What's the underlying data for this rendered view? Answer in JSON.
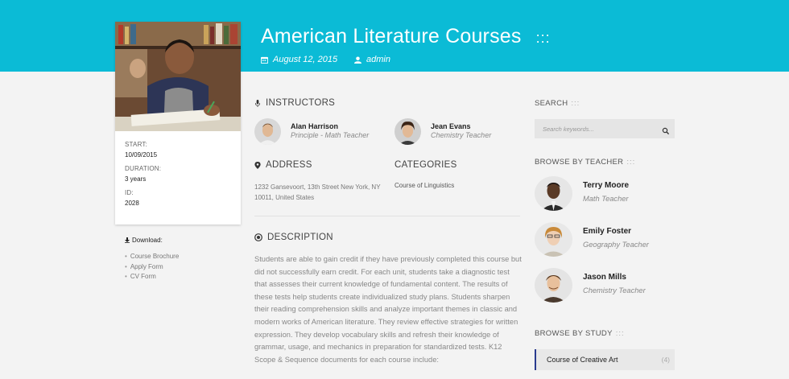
{
  "course": {
    "title": "American Literature Courses",
    "title_dots": ":::",
    "date": "August 12, 2015",
    "author": "admin"
  },
  "info": {
    "start_label": "START:",
    "start_value": "10/09/2015",
    "duration_label": "DURATION:",
    "duration_value": "3 years",
    "id_label": "ID:",
    "id_value": "2028"
  },
  "downloads": {
    "label": "Download:",
    "items": [
      "Course Brochure",
      "Apply Form",
      "CV Form"
    ]
  },
  "instructors": {
    "heading": "INSTRUCTORS",
    "items": [
      {
        "name": "Alan Harrison",
        "role": "Principle - Math Teacher"
      },
      {
        "name": "Jean Evans",
        "role": "Chemistry Teacher"
      }
    ]
  },
  "address": {
    "heading": "ADDRESS",
    "text": "1232 Gansevoort, 13th Street New York, NY 10011, United States"
  },
  "categories": {
    "heading": "CATEGORIES",
    "item": "Course of Linguistics"
  },
  "description": {
    "heading": "DESCRIPTION",
    "text": "Students are able to gain credit if they have previously completed this course but did not successfully earn credit. For each unit, students take a diagnostic test that assesses their current knowledge of fundamental content. The results of these tests help students create individualized study plans. Students sharpen their reading comprehension skills and analyze important themes in classic and modern works of American literature. They review effective strategies for written expression. They develop vocabulary skills and refresh their knowledge of grammar, usage, and mechanics in preparation for standardized tests. K12 Scope & Sequence documents for each course include:"
  },
  "sidebar": {
    "search_heading": "SEARCH",
    "search_placeholder": "Search keywords...",
    "teacher_heading": "BROWSE BY TEACHER",
    "teachers": [
      {
        "name": "Terry Moore",
        "role": "Math Teacher"
      },
      {
        "name": "Emily Foster",
        "role": "Geography Teacher"
      },
      {
        "name": "Jason Mills",
        "role": "Chemistry Teacher"
      }
    ],
    "study_heading": "BROWSE BY STUDY",
    "study_items": [
      {
        "label": "Course of Creative Art",
        "count": "(4)"
      }
    ],
    "dots": ":::"
  },
  "colors": {
    "header": "#0bbbd6",
    "active_border": "#2a3b8f"
  }
}
